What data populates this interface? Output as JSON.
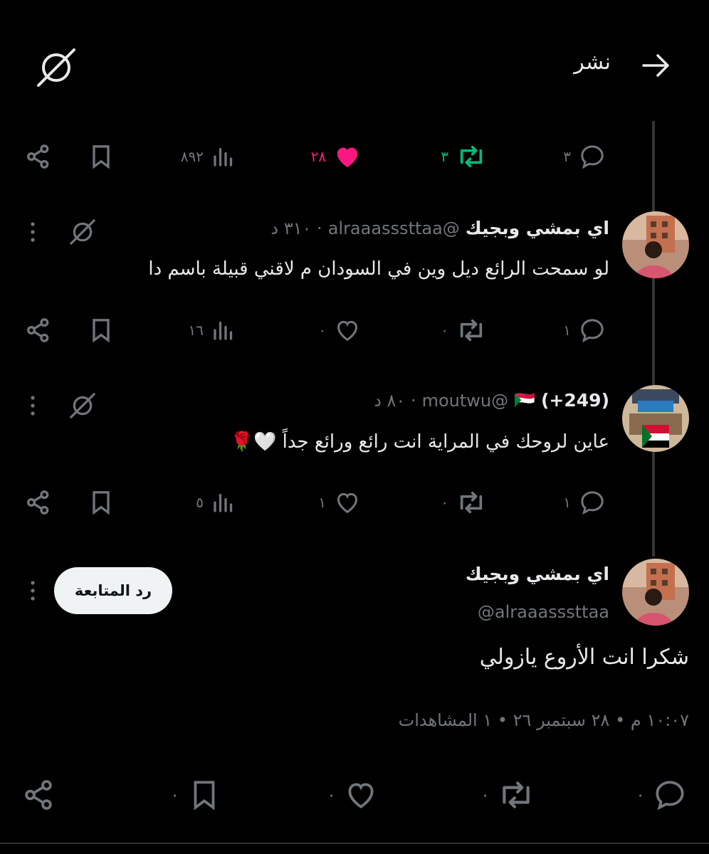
{
  "header": {
    "title": "نشر",
    "back_icon": "arrow-right-icon",
    "grok_icon": "grok-icon"
  },
  "main_tweet_actions": {
    "replies": "٣",
    "reposts": "٣",
    "likes": "٢٨",
    "views": "٨٩٢"
  },
  "reply1": {
    "name": "اي بمشي وبجيك",
    "handle": "@alraaasssttaa",
    "time": "· ٣١٠ د",
    "text": "لو سمحت الرائع ديل وين في السودان م لاقني قبيلة باسم دا",
    "replies": "١",
    "reposts": "٠",
    "likes": "٠",
    "views": "١٦"
  },
  "reply2": {
    "name": "(249+)",
    "flag": "🇸🇩",
    "handle": "@moutwu",
    "time": "· ٨٠ د",
    "text": "عاين لروحك في المراية انت رائع ورائع جداً 🤍🌹",
    "replies": "١",
    "reposts": "٠",
    "likes": "١",
    "views": "٥"
  },
  "focused": {
    "name": "اي بمشي وبجيك",
    "handle": "@alraaasssttaa",
    "follow_label": "رد المتابعة",
    "text": "شكرا انت الأروع يازولي",
    "meta": "١٠:٠٧ م • ٢٨ سبتمبر ٢٦ • ١ المشاهدات",
    "replies": "٠",
    "reposts": "٠",
    "likes": "٠",
    "bookmarks": "٠"
  },
  "colors": {
    "background": "#000000",
    "like_active": "#f91880",
    "repost_active": "#00ba7c",
    "muted": "#71767b",
    "text": "#e7e9ea"
  }
}
